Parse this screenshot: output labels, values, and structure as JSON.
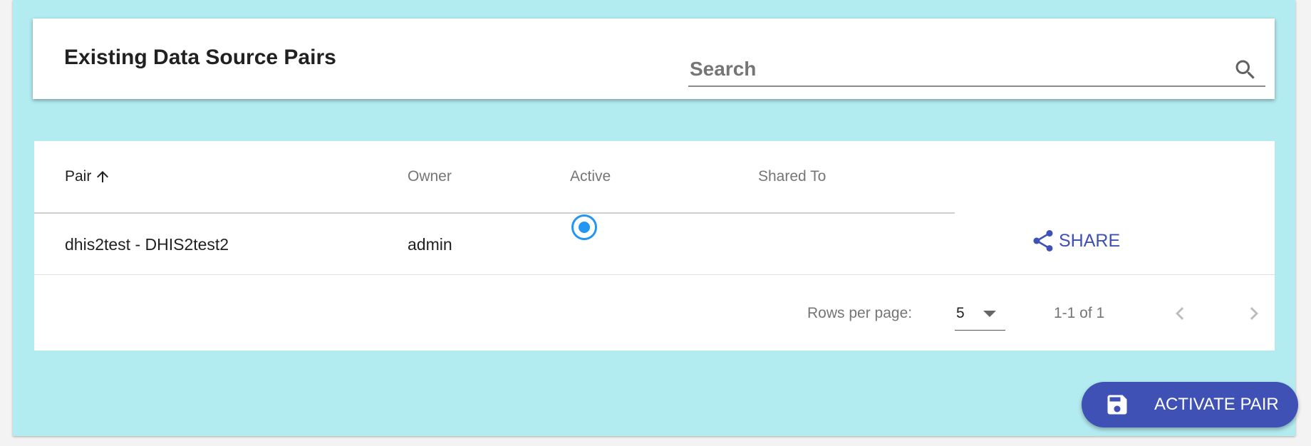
{
  "header": {
    "title": "Existing Data Source Pairs",
    "search_placeholder": "Search",
    "search_value": ""
  },
  "table": {
    "columns": {
      "pair": "Pair",
      "owner": "Owner",
      "active": "Active",
      "shared_to": "Shared To"
    },
    "sort": {
      "column": "pair",
      "direction": "ascending"
    },
    "rows": [
      {
        "pair": "dhis2test - DHIS2test2",
        "owner": "admin",
        "active": true,
        "shared_to": "",
        "action_label": "SHARE"
      }
    ]
  },
  "pagination": {
    "rows_per_page_label": "Rows per page:",
    "rows_per_page_value": "5",
    "range_text": "1-1 of 1"
  },
  "actions": {
    "activate_label": "ACTIVATE PAIR"
  },
  "colors": {
    "panel_bg": "#b2ebf0",
    "accent": "#3f51b5",
    "radio": "#2196f3"
  },
  "icons": {
    "search": "search-icon",
    "sort": "arrow-up-icon",
    "share": "share-icon",
    "save": "save-icon",
    "prev": "chevron-left-icon",
    "next": "chevron-right-icon"
  }
}
